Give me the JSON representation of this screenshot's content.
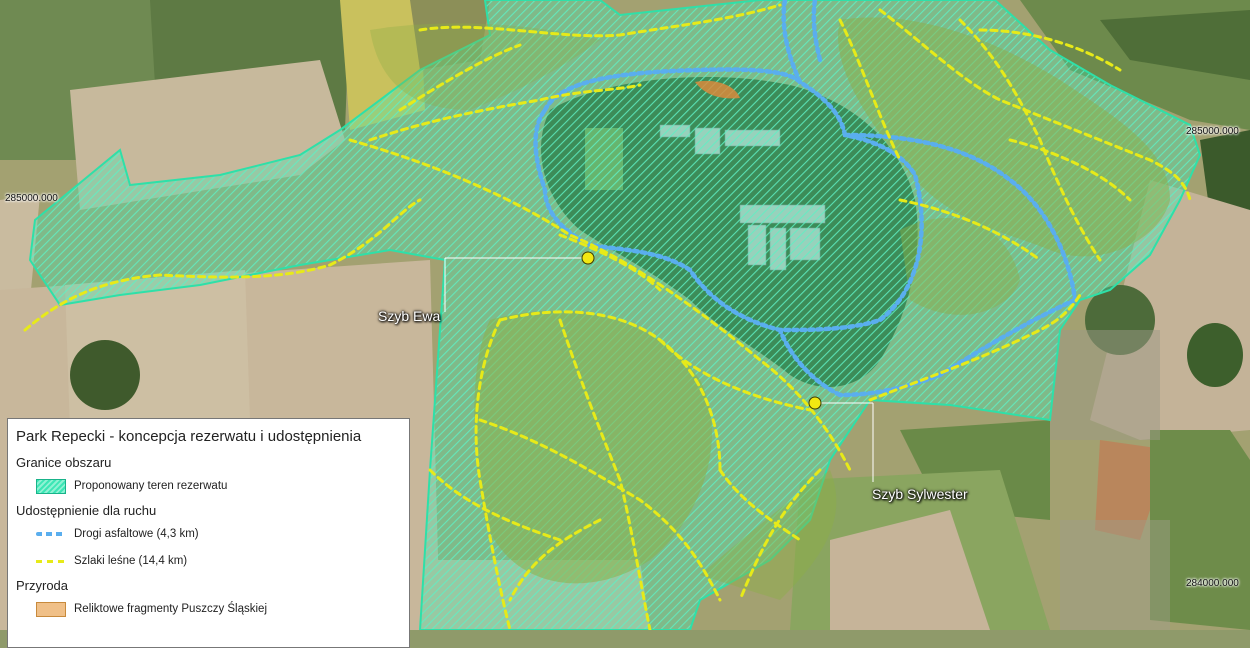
{
  "legend": {
    "title": "Park Repecki - koncepcja rezerwatu i udostępnienia",
    "groups": [
      {
        "name": "Granice obszaru",
        "items": [
          {
            "label": "Proponowany teren rezerwatu",
            "symbol": "hatch",
            "color": "#3ce6b5"
          }
        ]
      },
      {
        "name": "Udostępnienie dla ruchu",
        "items": [
          {
            "label": "Drogi asfaltowe (4,3 km)",
            "symbol": "dashed-line",
            "color": "#5aaeee"
          },
          {
            "label": "Szlaki leśne (14,4 km)",
            "symbol": "dashed-line",
            "color": "#e7ea19"
          }
        ]
      },
      {
        "name": "Przyroda",
        "items": [
          {
            "label": "Reliktowe fragmenty Puszczy Śląskiej",
            "symbol": "fill",
            "color": "#f0c088"
          }
        ]
      }
    ]
  },
  "points": [
    {
      "name": "Szyb Ewa",
      "color": "#f2e812"
    },
    {
      "name": "Szyb Sylwester",
      "color": "#f2e812"
    }
  ],
  "grid_labels": {
    "left_285000": "285000.000",
    "right_285000": "285000.000",
    "right_284000": "284000.000"
  },
  "colors": {
    "reserve": "#3ce6b5",
    "roads": "#5aaeee",
    "trails": "#e7ea19",
    "relict": "#f0c088"
  }
}
